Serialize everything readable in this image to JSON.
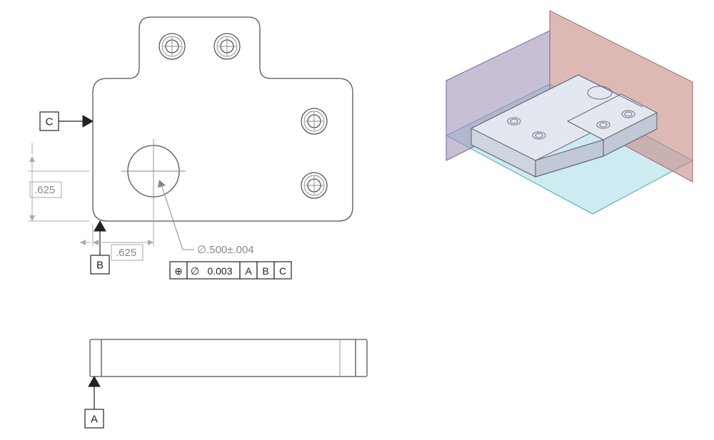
{
  "datums": {
    "A": "A",
    "B": "B",
    "C": "C"
  },
  "dimensions": {
    "vert_offset": ".625",
    "horiz_offset": ".625",
    "hole_dia": "∅.500±.004"
  },
  "fcf": {
    "symbol": "⊕",
    "dia_symbol": "∅",
    "tolerance": "0.003",
    "primary": "A",
    "secondary": "B",
    "tertiary": "C"
  }
}
